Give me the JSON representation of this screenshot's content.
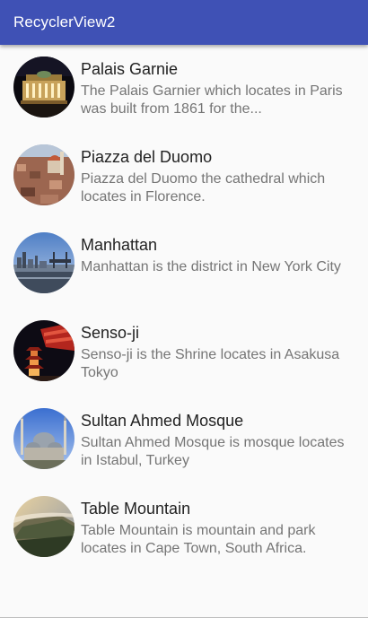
{
  "app_bar": {
    "title": "RecyclerView2",
    "color": "#3f51b5"
  },
  "items": [
    {
      "title": "Palais Garnie",
      "description": "The Palais Garnier which locates in Paris was built from 1861 for the...",
      "image": "palais-garnier-photo"
    },
    {
      "title": "Piazza del Duomo",
      "description": "Piazza del Duomo the cathedral which locates in Florence.",
      "image": "piazza-del-duomo-photo"
    },
    {
      "title": "Manhattan",
      "description": "Manhattan is the district in New York City",
      "image": "manhattan-photo"
    },
    {
      "title": "Senso-ji",
      "description": "Senso-ji is the Shrine locates in Asakusa Tokyo",
      "image": "senso-ji-photo"
    },
    {
      "title": "Sultan Ahmed Mosque",
      "description": "Sultan Ahmed Mosque is mosque locates in Istabul, Turkey",
      "image": "sultan-ahmed-mosque-photo"
    },
    {
      "title": "Table Mountain",
      "description": "Table Mountain is mountain and park locates in Cape Town, South Africa.",
      "image": "table-mountain-photo"
    }
  ]
}
